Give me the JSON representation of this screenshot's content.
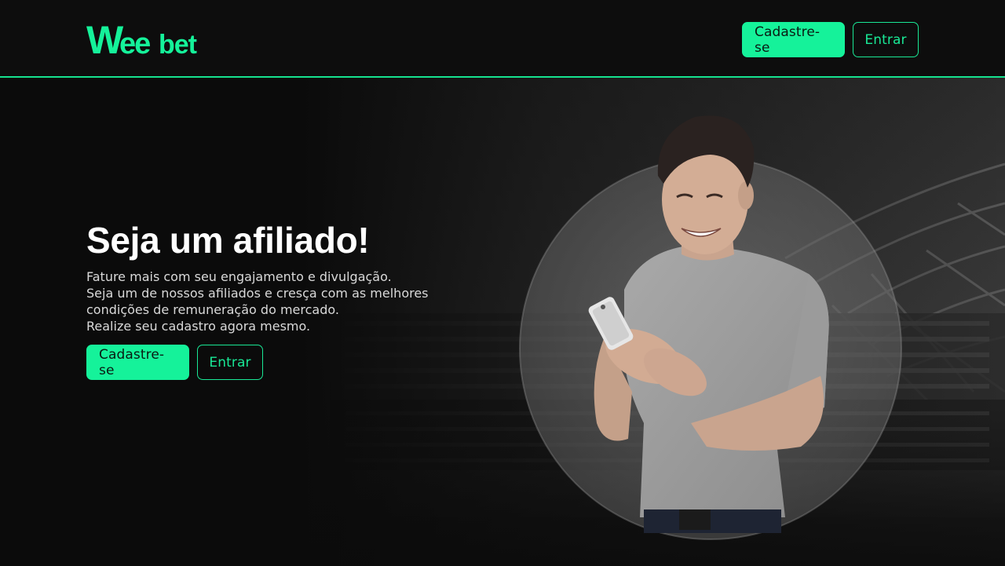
{
  "brand": {
    "logo_text": "Weebet",
    "accent_color": "#15f29a",
    "background_color": "#0b0b0b"
  },
  "header": {
    "signup_label": "Cadastre-se",
    "login_label": "Entrar"
  },
  "hero": {
    "title": "Seja um afiliado!",
    "lines": [
      "Fature mais com seu engajamento e divulgação.",
      "Seja um de nossos afiliados e cresça com as melhores",
      "condições de remuneração do mercado.",
      "Realize seu cadastro agora mesmo."
    ],
    "signup_label": "Cadastre-se",
    "login_label": "Entrar",
    "image_subject": "smiling man in grey t-shirt holding a smartphone in front of a stadium"
  }
}
